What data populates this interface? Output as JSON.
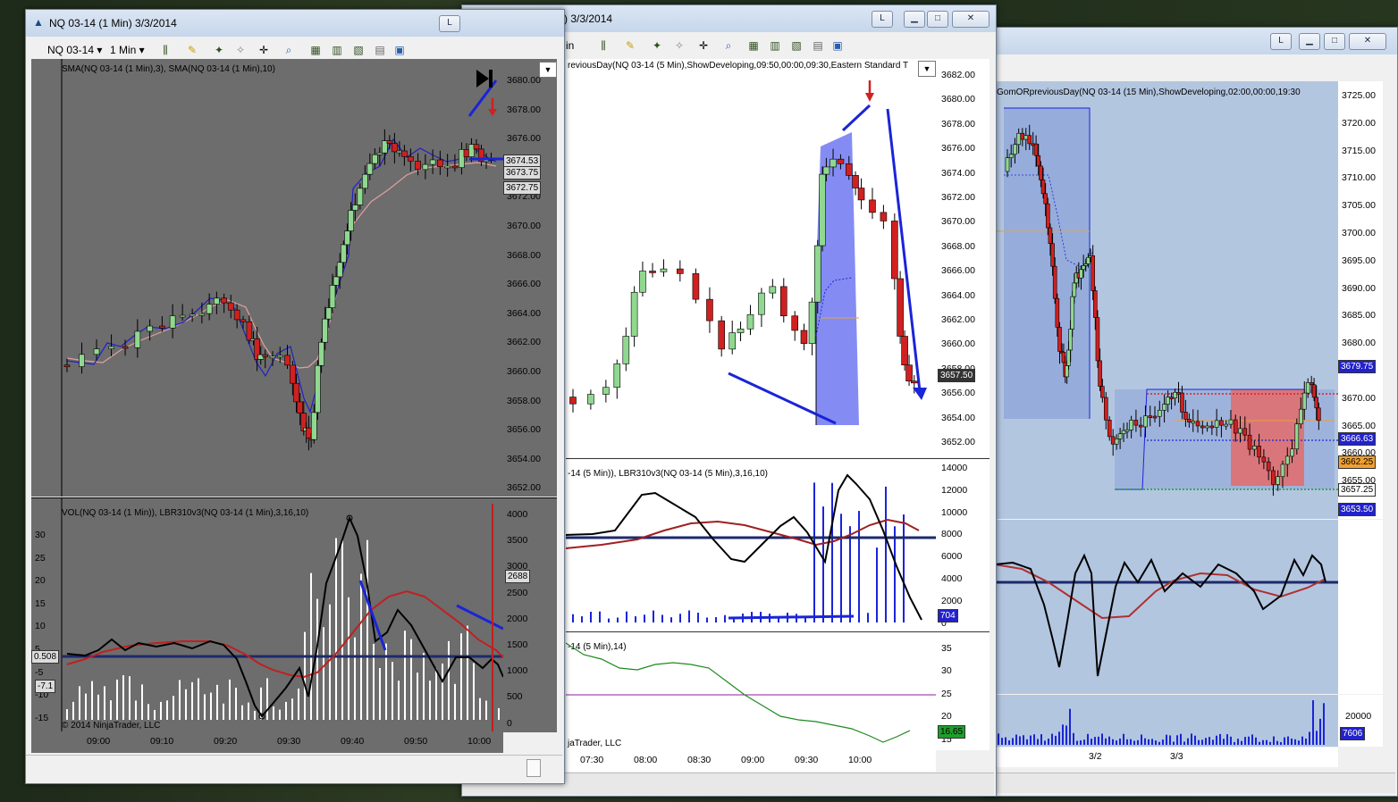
{
  "win_left": {
    "title": "NQ 03-14 (1 Min)  3/3/2014",
    "instrument": "NQ 03-14",
    "interval": "1 Min",
    "price_label": "SMA(NQ 03-14 (1 Min),3), SMA(NQ 03-14 (1 Min),10)",
    "ind_label": "VOL(NQ 03-14 (1 Min)), LBR310v3(NQ 03-14 (1 Min),3,16,10)",
    "copyright": "© 2014 NinjaTrader, LLC",
    "price_ticks": [
      "3680.00",
      "3678.00",
      "3676.00",
      "3674.00",
      "3672.00",
      "3670.00",
      "3668.00",
      "3666.00",
      "3664.00",
      "3662.00",
      "3660.00",
      "3658.00",
      "3656.00",
      "3654.00",
      "3652.00"
    ],
    "price_flags": [
      "3674.53",
      "3673.75",
      "3672.75"
    ],
    "vol_ticks": [
      "4000",
      "3500",
      "3000",
      "2500",
      "2000",
      "1500",
      "1000",
      "500",
      "0"
    ],
    "vol_flag": "2688",
    "osc_ticks": [
      "30",
      "25",
      "20",
      "15",
      "10",
      "5",
      "-5",
      "-10",
      "-15"
    ],
    "osc_flags": [
      "0.508",
      "-7.1"
    ],
    "time_ticks": [
      "09:00",
      "09:10",
      "09:20",
      "09:30",
      "09:40",
      "09:50",
      "10:00"
    ]
  },
  "win_mid": {
    "title": ")  3/3/2014",
    "interval_frag": "in",
    "price_label": "reviousDay(NQ 03-14 (5 Min),ShowDeveloping,09:50,00:00,09:30,Eastern Standard T",
    "ind_label": "-14 (5 Min)), LBR310v3(NQ 03-14 (5 Min),3,16,10)",
    "adx_label": "-14 (5 Min),14)",
    "copyright": "jaTrader, LLC",
    "price_ticks": [
      "3682.00",
      "3680.00",
      "3678.00",
      "3676.00",
      "3674.00",
      "3672.00",
      "3670.00",
      "3668.00",
      "3666.00",
      "3664.00",
      "3662.00",
      "3660.00",
      "3658.00",
      "3656.00",
      "3654.00",
      "3652.00"
    ],
    "price_flag": "3657.50",
    "vol_ticks": [
      "14000",
      "12000",
      "10000",
      "8000",
      "6000",
      "4000",
      "2000",
      "0"
    ],
    "vol_flag": "704",
    "adx_ticks": [
      "35",
      "30",
      "25",
      "20",
      "15"
    ],
    "adx_flag": "16.65",
    "time_ticks": [
      "07:30",
      "08:00",
      "08:30",
      "09:00",
      "09:30",
      "10:00"
    ]
  },
  "win_right": {
    "price_label": "GomORpreviousDay(NQ 03-14 (15 Min),ShowDeveloping,02:00,00:00,19:30",
    "price_ticks": [
      "3725.00",
      "3720.00",
      "3715.00",
      "3710.00",
      "3705.00",
      "3700.00",
      "3695.00",
      "3690.00",
      "3685.00",
      "3680.00",
      "3675.00",
      "3670.00",
      "3665.00",
      "3660.00",
      "3655.00",
      "3650.00"
    ],
    "price_flags": [
      "3679.75",
      "3666.63",
      "3662.25",
      "3657.25",
      "3653.50"
    ],
    "vol_ticks": [
      "20000"
    ],
    "vol_flag": "7606",
    "time_ticks": [
      "3/2",
      "3/3"
    ]
  },
  "colors": {
    "left_bg": "#6d6d6d",
    "mid_bg": "#ffffff",
    "right_bg": "#b3c6e0",
    "up_candle": "#90d890",
    "down_candle": "#d02020",
    "annotation": "#1a24d8"
  },
  "buttons": {
    "l": "L"
  }
}
